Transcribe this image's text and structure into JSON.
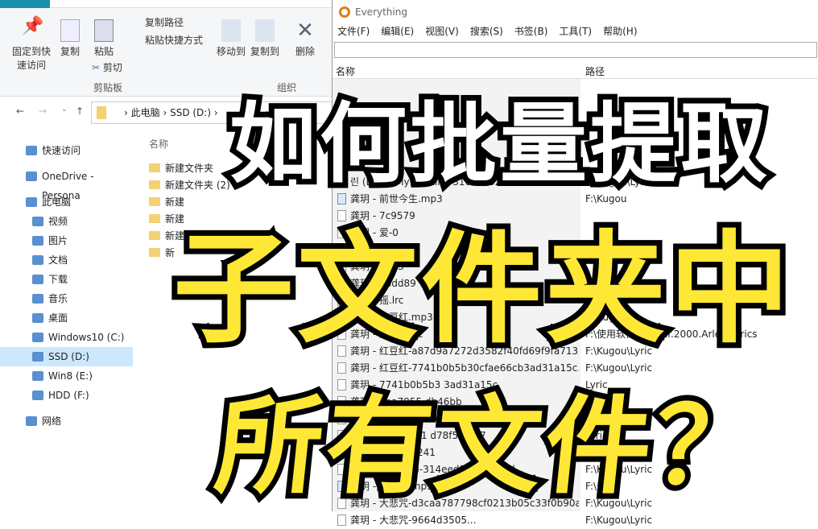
{
  "explorer": {
    "ribbon": {
      "pin": "固定到快速访问",
      "copy": "复制",
      "paste": "粘贴",
      "copy_path": "复制路径",
      "paste_shortcut": "粘贴快捷方式",
      "cut": "剪切",
      "clipboard_group": "剪贴板",
      "move_to": "移动到",
      "copy_to": "复制到",
      "delete": "删除",
      "organize_group": "组织"
    },
    "breadcrumb": [
      "此电脑",
      "SSD (D:)"
    ],
    "nav": [
      {
        "label": "快速访问",
        "icon": "star-icon"
      },
      {
        "label": "OneDrive - Persona",
        "icon": "cloud-icon"
      },
      {
        "label": "此电脑",
        "icon": "computer-icon"
      },
      {
        "label": "视频",
        "icon": "video-icon"
      },
      {
        "label": "图片",
        "icon": "picture-icon"
      },
      {
        "label": "文档",
        "icon": "document-icon"
      },
      {
        "label": "下载",
        "icon": "download-icon"
      },
      {
        "label": "音乐",
        "icon": "music-icon"
      },
      {
        "label": "桌面",
        "icon": "desktop-icon"
      },
      {
        "label": "Windows10 (C:)",
        "icon": "drive-icon"
      },
      {
        "label": "SSD (D:)",
        "icon": "drive-icon",
        "selected": true
      },
      {
        "label": "Win8 (E:)",
        "icon": "drive-icon"
      },
      {
        "label": "HDD (F:)",
        "icon": "drive-icon"
      },
      {
        "label": "网络",
        "icon": "network-icon"
      }
    ],
    "column_name": "名称",
    "files": [
      "新建文件夹",
      "新建文件夹 (2)",
      "新建",
      "新建",
      "新建文件夹",
      "新"
    ]
  },
  "everything": {
    "title": "Everything",
    "menu": [
      "文件(F)",
      "编辑(E)",
      "视图(V)",
      "搜索(S)",
      "书签(B)",
      "工具(T)",
      "帮助(H)"
    ],
    "search_value": "",
    "columns": {
      "name": "名称",
      "path": "路径"
    },
    "rows": [
      {
        "name": "",
        "path": "F:\\",
        "type": "file"
      },
      {
        "name": "",
        "path": "",
        "type": "file"
      },
      {
        "name": "린 (LYn) - My Destiny-31626c320fa6009d92bc81...",
        "path": "F:\\Kugou\\Lyric",
        "type": "file"
      },
      {
        "name": "龚玥 - 前世今生.mp3",
        "path": "F:\\Kugou",
        "type": "mp3"
      },
      {
        "name": "龚玥 - 7c9579",
        "path": "",
        "type": "file"
      },
      {
        "name": "龚玥 - 爱-0",
        "path": "",
        "type": "file"
      },
      {
        "name": "龚玥 - aa867",
        "path": "F:",
        "type": "file"
      },
      {
        "name": "龚玥 - .mp3",
        "path": "",
        "type": "file"
      },
      {
        "name": "龚玥 - 88dd89",
        "path": "",
        "type": "file"
      },
      {
        "name": "龚玥 - 摇.lrc",
        "path": "oad\\Lyric",
        "type": "file"
      },
      {
        "name": "龚玥 - 红豆红.mp3",
        "path": "F:\\Kugou",
        "type": "mp3"
      },
      {
        "name": "龚玥 - 红豆红.lrc",
        "path": "F:\\使用软件\\Foobar.2000.Arlen\\Lyrics",
        "type": "file"
      },
      {
        "name": "龚玥 - 红豆红-a87d9a7272d3582f40fd69f9fa713...",
        "path": "F:\\Kugou\\Lyric",
        "type": "file"
      },
      {
        "name": "龚玥 - 红豆红-7741b0b5b30cfae66cb3ad31a15c...",
        "path": "F:\\Kugou\\Lyric",
        "type": "file"
      },
      {
        "name": "龚玥 - 7741b0b5b3 3ad31a15c",
        "path": "Lyric",
        "type": "file"
      },
      {
        "name": "龚玥 - 3ba7955 db46bb",
        "path": "",
        "type": "file"
      },
      {
        "name": "龚玥 - 9fb9863 54dd7e9",
        "path": "",
        "type": "file"
      },
      {
        "name": "龚玥 - cff18c931 d78f5f0e37",
        "path": "Lyric",
        "type": "file"
      },
      {
        "name": "龚玥 - 花-27a f241",
        "path": "F:\\ Lyric",
        "type": "file"
      },
      {
        "name": "龚玥 - 好 (DJ版)-314eed3d0 f2231d...",
        "path": "F:\\Kugou\\Lyric",
        "type": "file"
      },
      {
        "name": "龚玥 - 大悲咒.mp3",
        "path": "F:\\音乐",
        "type": "mp3"
      },
      {
        "name": "龚玥 - 大悲咒-d3caa787798cf0213b05c33f0b90a...",
        "path": "F:\\Kugou\\Lyric",
        "type": "file"
      },
      {
        "name": "龚玥 - 大悲咒-9664d3505...",
        "path": "F:\\Kugou\\Lyric",
        "type": "file"
      }
    ]
  },
  "overlay": {
    "line1": "如何批量提取",
    "line2": "子文件夹中",
    "line3": "所有文件？"
  },
  "colors": {
    "overlay_yellow": "#ffe835",
    "accent": "#1a8fb0",
    "selected": "#cce8ff"
  }
}
